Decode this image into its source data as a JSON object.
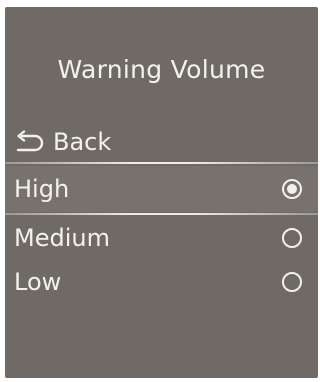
{
  "colors": {
    "screen_background": "#6f6a66",
    "text": "#f3f1ee",
    "selected_row": "#77726e"
  },
  "screen": {
    "title": "Warning Volume",
    "back": {
      "label": "Back",
      "icon": "return-arrow-icon"
    },
    "options": [
      {
        "label": "High",
        "selected": true
      },
      {
        "label": "Medium",
        "selected": false
      },
      {
        "label": "Low",
        "selected": false
      }
    ]
  }
}
